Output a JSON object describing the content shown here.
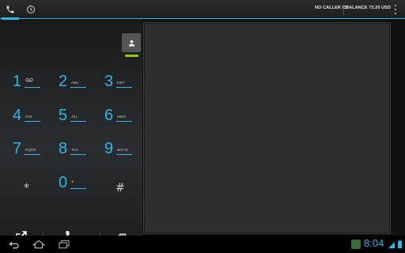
{
  "tabs": [
    {
      "name": "dialpad",
      "icon": "phone-icon",
      "active": true
    },
    {
      "name": "call-log",
      "icon": "clock-icon",
      "active": false
    }
  ],
  "topbar": {
    "caller_id": "NO CALLER ID!",
    "balance": "BALANCE 73.20 USD"
  },
  "dialpad": {
    "keys": [
      {
        "digit": "1",
        "letters": ""
      },
      {
        "digit": "2",
        "letters": "ABC"
      },
      {
        "digit": "3",
        "letters": "DEF"
      },
      {
        "digit": "4",
        "letters": "GHI"
      },
      {
        "digit": "5",
        "letters": "JKL"
      },
      {
        "digit": "6",
        "letters": "MNO"
      },
      {
        "digit": "7",
        "letters": "PQRS"
      },
      {
        "digit": "8",
        "letters": "TUV"
      },
      {
        "digit": "9",
        "letters": "WXYZ"
      },
      {
        "digit": "*",
        "letters": ""
      },
      {
        "digit": "0",
        "letters": "+"
      },
      {
        "digit": "#",
        "letters": ""
      }
    ]
  },
  "statusbar": {
    "time": "8:04"
  },
  "colors": {
    "accent": "#33b5e5",
    "green": "#99cc00"
  }
}
